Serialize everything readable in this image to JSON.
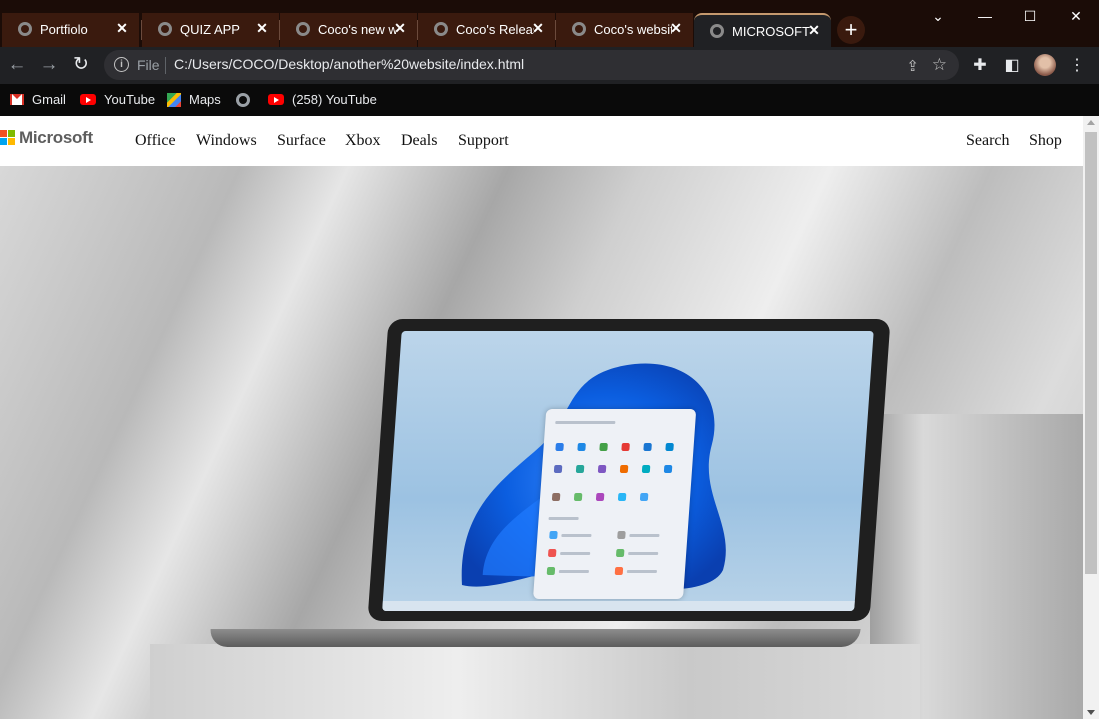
{
  "browser": {
    "tabs": [
      {
        "title": "Portfiolo"
      },
      {
        "title": "QUIZ APP"
      },
      {
        "title": "Coco's new website"
      },
      {
        "title": "Coco's Release"
      },
      {
        "title": "Coco's website"
      },
      {
        "title": "MICROSOFT Website"
      }
    ],
    "new_tab": "+",
    "url_scheme": "File",
    "url": "C:/Users/COCO/Desktop/another%20website/index.html",
    "bookmarks": [
      {
        "label": "Gmail",
        "icon": "gmail-icon"
      },
      {
        "label": "YouTube",
        "icon": "youtube-icon"
      },
      {
        "label": "Maps",
        "icon": "maps-icon"
      },
      {
        "label": "",
        "icon": "globe-icon"
      },
      {
        "label": "(258) YouTube",
        "icon": "youtube-icon"
      }
    ]
  },
  "site": {
    "logo_text": "Microsoft",
    "nav": [
      "Office",
      "Windows",
      "Surface",
      "Xbox",
      "Deals",
      "Support"
    ],
    "nav_right": [
      "Search",
      "Shop"
    ]
  },
  "colors": {
    "tabstrip_bg": "#1b0c07",
    "tab_bg": "#3a1a0e",
    "active_tab_accent": "#c4996e",
    "toolbar_bg": "#202124",
    "bookmarks_bg": "#0a0a0a",
    "ms_red": "#f25022",
    "ms_green": "#7fba00",
    "ms_blue": "#00a4ef",
    "ms_yellow": "#ffb900"
  }
}
